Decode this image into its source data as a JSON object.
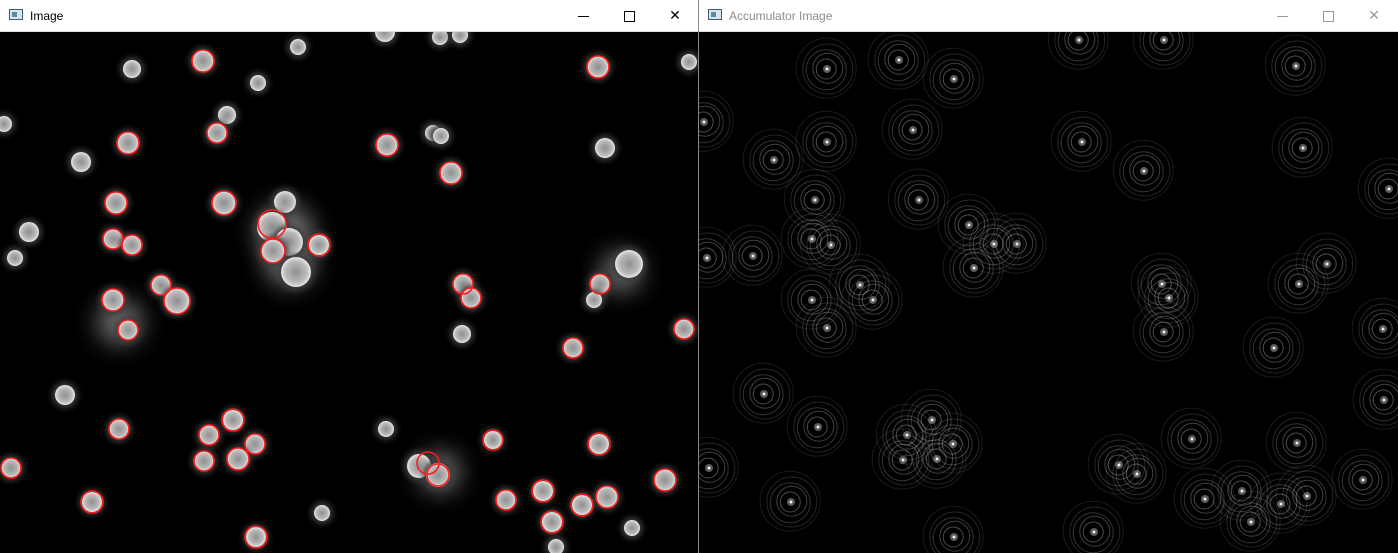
{
  "windows": {
    "left": {
      "title": "Image",
      "controls": [
        "minimize-icon",
        "maximize-icon",
        "close-icon"
      ],
      "close_glyph": "✕"
    },
    "right": {
      "title": "Accumulator Image",
      "controls": [
        "minimize-icon",
        "maximize-icon",
        "close-icon"
      ],
      "close_glyph": "✕"
    }
  },
  "colors": {
    "detection_circle": "#ff1a1a",
    "canvas_background": "#000000",
    "cell_fill": "#d9d9d9",
    "accumulator_ring": "#bbbbbb"
  }
}
